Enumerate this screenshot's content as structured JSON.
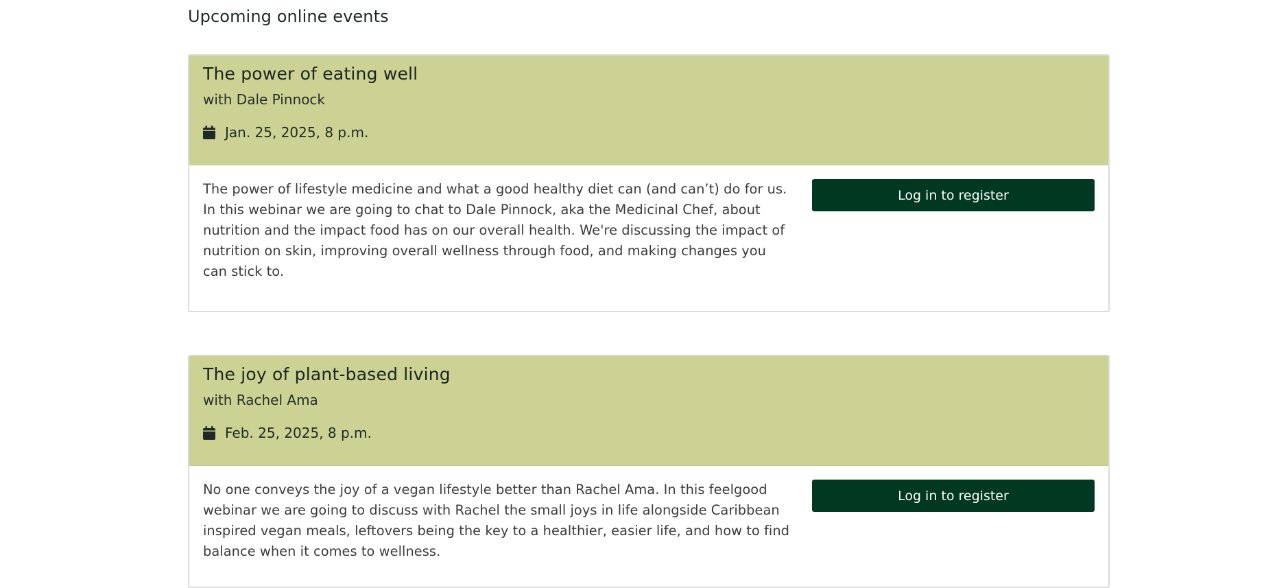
{
  "section": {
    "title": "Upcoming online events"
  },
  "events": [
    {
      "title": "The power of eating well",
      "host": "with Dale Pinnock",
      "date": "Jan. 25, 2025, 8 p.m.",
      "description": "The power of lifestyle medicine and what a good healthy diet can (and can’t) do for us. In this webinar we are going to chat to Dale Pinnock, aka the Medicinal Chef, about nutrition and the impact food has on our overall health. We're discussing the impact of nutrition on skin, improving overall wellness through food, and making changes you can stick to.",
      "button_label": "Log in to register"
    },
    {
      "title": "The joy of plant-based living",
      "host": "with Rachel Ama",
      "date": "Feb. 25, 2025, 8 p.m.",
      "description": "No one conveys the joy of a vegan lifestyle better than Rachel Ama. In this feelgood webinar we are going to discuss with Rachel the small joys in life alongside Caribbean inspired vegan meals, leftovers being the key to a healthier, easier life, and how to find balance when it comes to wellness.",
      "button_label": "Log in to register"
    }
  ],
  "colors": {
    "header_bg": "#ccd194",
    "button_bg": "#003821",
    "button_text": "#ffffff",
    "card_border": "#dcdcdc"
  },
  "icons": {
    "date": "calendar-icon"
  }
}
